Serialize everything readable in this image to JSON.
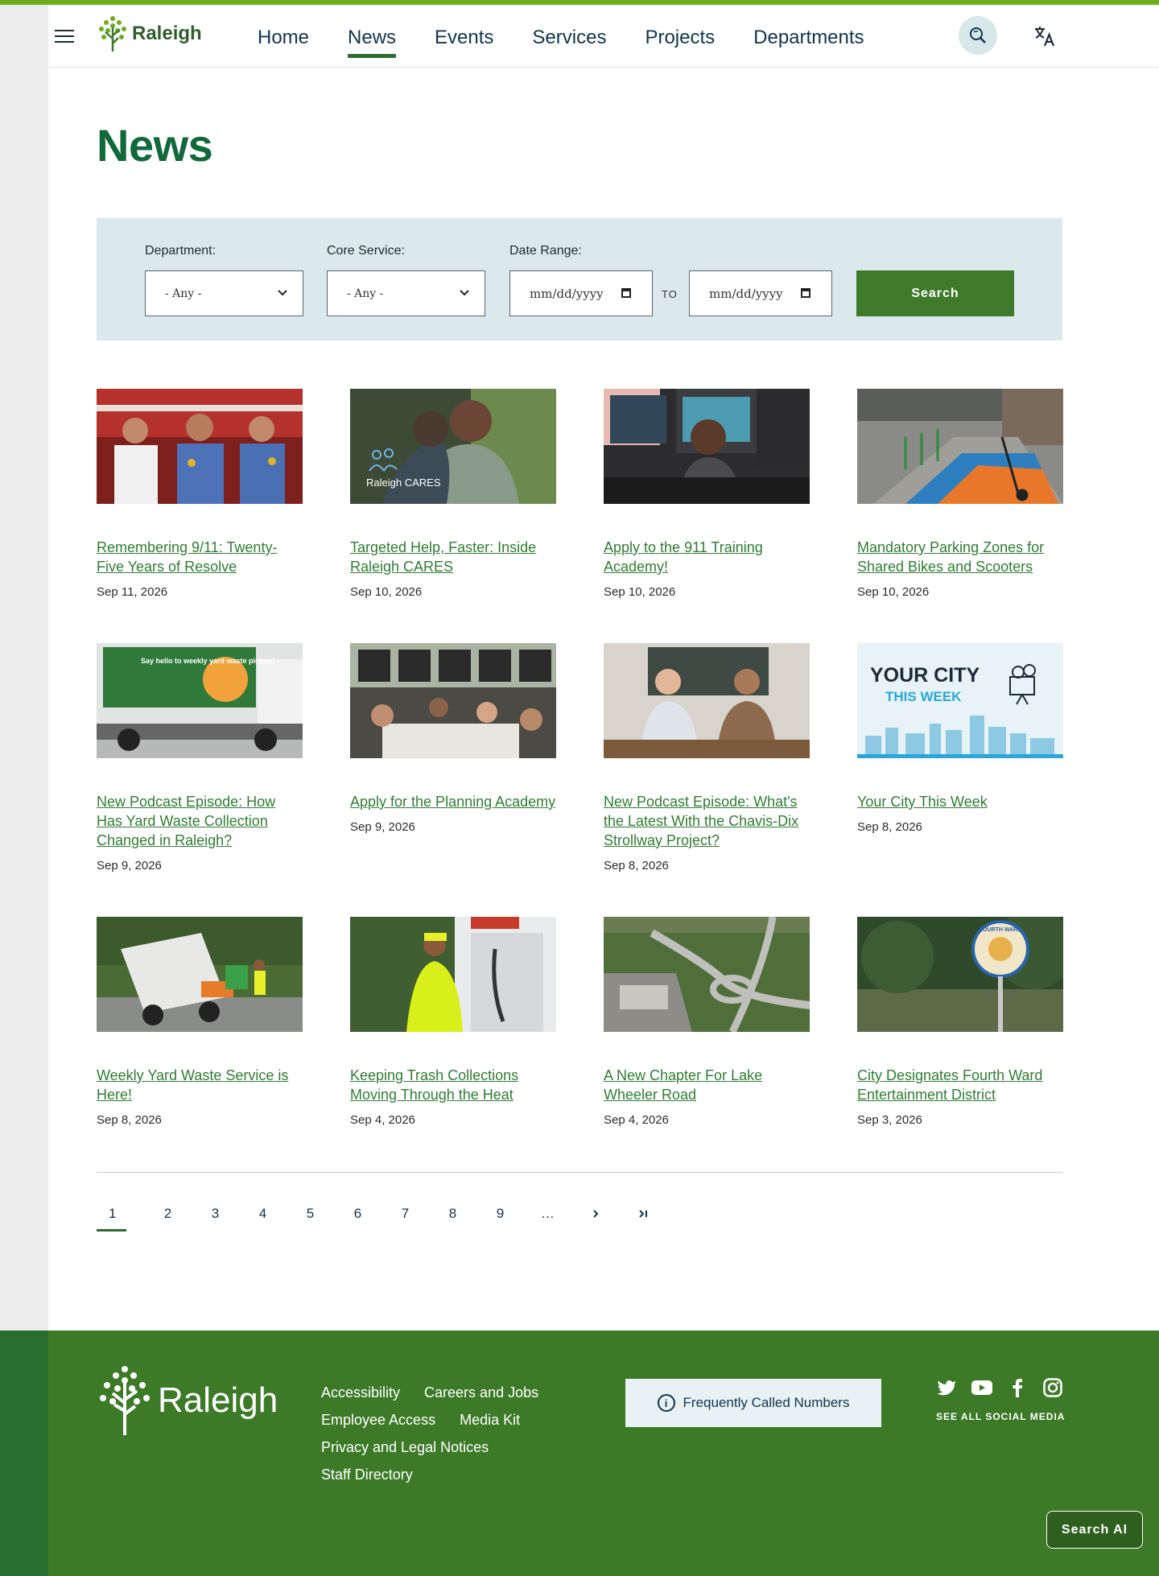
{
  "header": {
    "logo_text": "Raleigh",
    "nav": [
      "Home",
      "News",
      "Events",
      "Services",
      "Projects",
      "Departments"
    ],
    "active_nav": "News"
  },
  "page": {
    "title": "News"
  },
  "filters": {
    "department_label": "Department:",
    "department_value": "- Any -",
    "core_service_label": "Core Service:",
    "core_service_value": "- Any -",
    "date_range_label": "Date Range:",
    "date_from_placeholder": "mm/dd/yyyy",
    "date_to_placeholder": "mm/dd/yyyy",
    "to_label": "TO",
    "search_button": "Search"
  },
  "articles": [
    {
      "title": "Remembering 9/11: Twenty-Five Years of Resolve",
      "date": "Sep 11, 2026",
      "image": "firefighters-photo"
    },
    {
      "title": "Targeted Help, Faster: Inside Raleigh CARES",
      "date": "Sep 10, 2026",
      "image": "raleigh-cares-photo",
      "overlay": "Raleigh CARES"
    },
    {
      "title": "Apply to the 911 Training Academy!",
      "date": "Sep 10, 2026",
      "image": "dispatcher-photo"
    },
    {
      "title": "Mandatory Parking Zones for Shared Bikes and Scooters",
      "date": "Sep 10, 2026",
      "image": "scooter-parking-photo"
    },
    {
      "title": "New Podcast Episode: How Has Yard Waste Collection Changed in Raleigh?",
      "date": "Sep 9, 2026",
      "image": "yard-waste-truck-photo",
      "overlay": "Say hello to weekly yard waste pickup!"
    },
    {
      "title": "Apply for the Planning Academy",
      "date": "Sep 9, 2026",
      "image": "planning-academy-photo"
    },
    {
      "title": "New Podcast Episode: What's the Latest With the Chavis-Dix Strollway Project?",
      "date": "Sep 8, 2026",
      "image": "podcast-guests-photo"
    },
    {
      "title": "Your City This Week",
      "date": "Sep 8, 2026",
      "image": "your-city-this-week-graphic",
      "overlay": "YOUR CITY",
      "overlay2": "THIS WEEK"
    },
    {
      "title": "Weekly Yard Waste Service is Here!",
      "date": "Sep 8, 2026",
      "image": "garbage-truck-photo"
    },
    {
      "title": "Keeping Trash Collections Moving Through the Heat",
      "date": "Sep 4, 2026",
      "image": "sanitation-worker-photo"
    },
    {
      "title": "A New Chapter For Lake Wheeler Road",
      "date": "Sep 4, 2026",
      "image": "aerial-road-photo"
    },
    {
      "title": "City Designates Fourth Ward Entertainment District",
      "date": "Sep 3, 2026",
      "image": "fourth-ward-sign-photo",
      "overlay": "FOURTH WARD"
    }
  ],
  "pagination": {
    "pages": [
      "1",
      "2",
      "3",
      "4",
      "5",
      "6",
      "7",
      "8",
      "9",
      "…"
    ],
    "current": "1",
    "next": "›",
    "last": "›|"
  },
  "footer": {
    "logo_text": "Raleigh",
    "links_row1": [
      "Accessibility",
      "Careers and Jobs"
    ],
    "links_row2": [
      "Employee Access",
      "Media Kit"
    ],
    "links_row3": [
      "Privacy and Legal Notices"
    ],
    "links_row4": [
      "Staff Directory"
    ],
    "fcn_label": "Frequently Called Numbers",
    "social_icons": [
      "twitter-icon",
      "youtube-icon",
      "facebook-icon",
      "instagram-icon"
    ],
    "social_link": "SEE ALL SOCIAL MEDIA",
    "search_ai": "Search AI"
  },
  "colors": {
    "brand_green": "#11683a",
    "footer_green": "#3d7a28",
    "accent_lime": "#6cac1e",
    "link_green": "#2f7d32",
    "nav_blue": "#0f3550",
    "filter_bg": "#dbe9ed"
  }
}
